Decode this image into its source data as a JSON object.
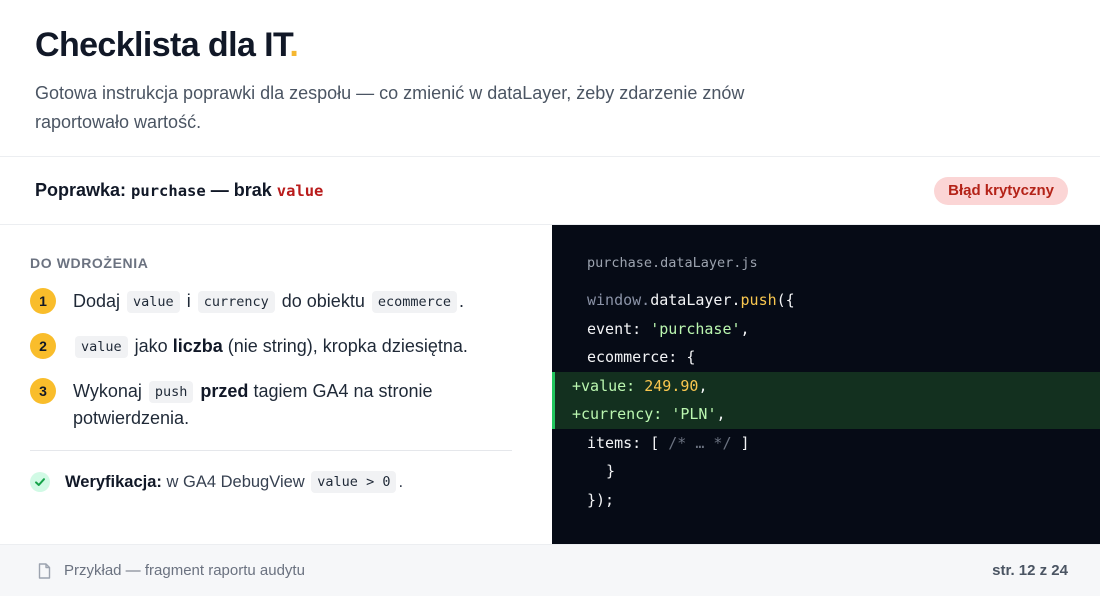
{
  "header": {
    "title": "Checklista dla IT",
    "title_dot": ".",
    "subtitle": "Gotowa instrukcja poprawki dla zespołu — co zmienić w dataLayer, żeby zdarzenie znów raportowało wartość.",
    "accent_color": "#f5b731"
  },
  "fix": {
    "label": "Poprawka:",
    "event_name": "purchase",
    "dash_text": " — brak ",
    "missing_field": "value",
    "badge": "Błąd krytyczny",
    "badge_color": "#fbd5d5"
  },
  "checklist": {
    "section_label": "DO WDROŻENIA",
    "steps": [
      {
        "number": "1",
        "t1": "Dodaj",
        "code1": "value",
        "t2": "i",
        "code2": "currency",
        "t3": "do obiektu",
        "code3": "ecommerce",
        "t4": "."
      },
      {
        "number": "2",
        "code1": "value",
        "t1": "jako",
        "bold": "liczba",
        "t2": "(nie string), kropka dziesiętna."
      },
      {
        "number": "3",
        "t1": "Wykonaj",
        "code1": "push",
        "bold": "przed",
        "t2": "tagiem GA4 na stronie potwierdzenia."
      }
    ],
    "verify": {
      "label": "Weryfikacja:",
      "text": "w GA4 DebugView",
      "code": "value > 0",
      "end": ".",
      "icon": "check-icon"
    }
  },
  "code": {
    "file_name": "purchase.dataLayer.js",
    "lines": {
      "l1_obj": "window.",
      "l1_prop": "dataLayer",
      "l1_dot": ".",
      "l1_fn": "push",
      "l1_end": "({",
      "l2_key": "event: ",
      "l2_val": "'purchase'",
      "l2_end": ",",
      "l3": "ecommerce: {",
      "l4_key": "+value: ",
      "l4_val": "249.90",
      "l4_end": ",",
      "l5_key": "+currency: ",
      "l5_val": "'PLN'",
      "l5_end": ",",
      "l6_key": "items: [ ",
      "l6_comment": "/* … */",
      "l6_end": " ]",
      "l7": "}",
      "l8": "});"
    }
  },
  "footer": {
    "text": "Przykład — fragment raportu audytu",
    "page": "str. 12 z 24",
    "icon": "document-icon"
  }
}
